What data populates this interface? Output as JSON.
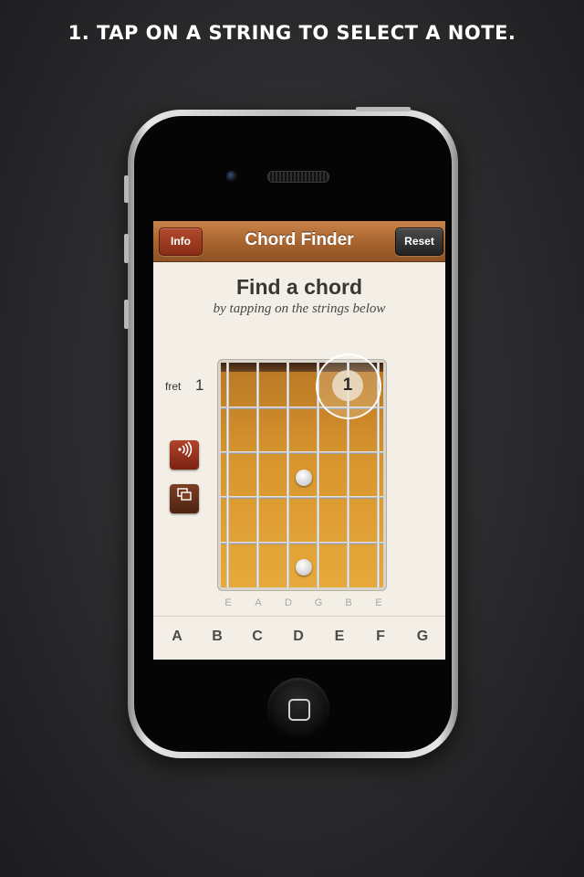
{
  "headline": "1. TAP ON A STRING TO SELECT A NOTE.",
  "navbar": {
    "title": "Chord Finder",
    "info_label": "Info",
    "reset_label": "Reset"
  },
  "content": {
    "title": "Find a chord",
    "subtitle": "by tapping on the strings below"
  },
  "fretboard": {
    "fret_label": "fret",
    "fret_number": "1",
    "selected_marker": "1",
    "string_names": [
      "E",
      "A",
      "D",
      "G",
      "B",
      "E"
    ]
  },
  "side_buttons": {
    "sound_icon": "sound-waves-icon",
    "copy_icon": "copy-icon"
  },
  "keys": [
    "A",
    "B",
    "C",
    "D",
    "E",
    "F",
    "G"
  ],
  "colors": {
    "nav_brown": "#a9652f",
    "info_red": "#8a2c15",
    "screen_bg": "#f3efe6"
  }
}
